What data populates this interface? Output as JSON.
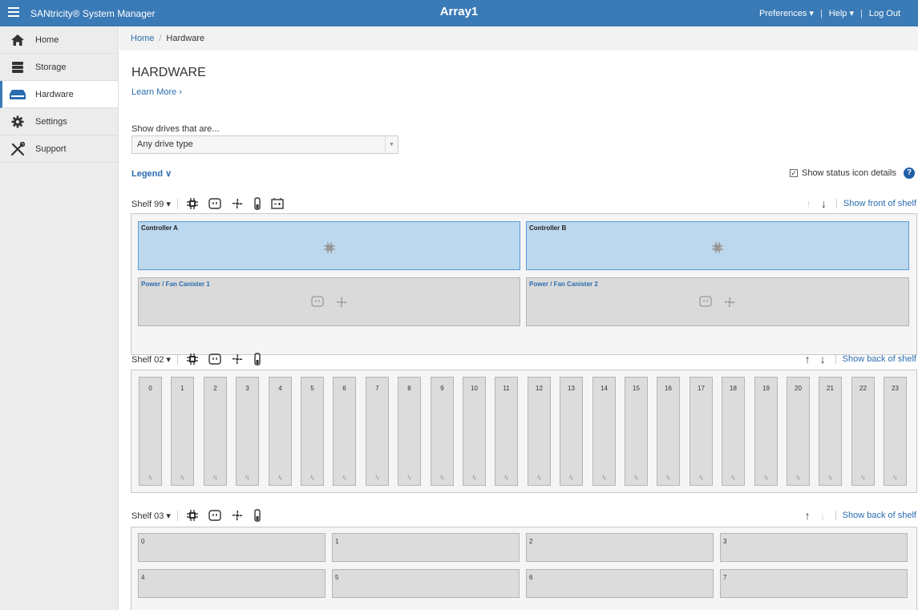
{
  "topbar": {
    "app_title": "SANtricity® System Manager",
    "array_name": "Array1",
    "preferences": "Preferences ▾",
    "help": "Help ▾",
    "logout": "Log Out",
    "separator": "|"
  },
  "sidebar": {
    "items": [
      {
        "label": "Home",
        "icon": "home-icon"
      },
      {
        "label": "Storage",
        "icon": "storage-icon"
      },
      {
        "label": "Hardware",
        "icon": "hardware-icon",
        "active": true
      },
      {
        "label": "Settings",
        "icon": "gear-icon"
      },
      {
        "label": "Support",
        "icon": "tools-icon"
      }
    ]
  },
  "breadcrumb": {
    "home": "Home",
    "separator": "/",
    "current": "Hardware"
  },
  "page": {
    "title": "HARDWARE",
    "learn_more": "Learn More ›",
    "filter_label": "Show drives that are...",
    "filter_value": "Any drive type",
    "filter_arrow": "▼",
    "legend": "Legend ∨",
    "status_details_checked": "✓",
    "status_details_label": "Show status icon details",
    "help_icon": "?"
  },
  "shelves": [
    {
      "name": "Shelf 99 ▾",
      "view_link": "Show front of shelf",
      "up_arrow": "↑",
      "down_arrow": "↓",
      "up_enabled": false,
      "down_enabled": true,
      "icons": [
        "controller-icon",
        "power-icon",
        "fan-icon",
        "temperature-icon",
        "battery-icon"
      ],
      "controllers": [
        "Controller A",
        "Controller B"
      ],
      "power_fan": [
        "Power / Fan Canister 1",
        "Power / Fan Canister 2"
      ]
    },
    {
      "name": "Shelf 02 ▾",
      "view_link": "Show back of shelf",
      "up_arrow": "↑",
      "down_arrow": "↓",
      "up_enabled": true,
      "down_enabled": true,
      "icons": [
        "controller-icon",
        "power-icon",
        "fan-icon",
        "temperature-icon"
      ],
      "bolt": "ϟ",
      "drives": [
        "0",
        "1",
        "2",
        "3",
        "4",
        "5",
        "6",
        "7",
        "8",
        "9",
        "10",
        "11",
        "12",
        "13",
        "14",
        "15",
        "16",
        "17",
        "18",
        "19",
        "20",
        "21",
        "22",
        "23"
      ]
    },
    {
      "name": "Shelf 03 ▾",
      "view_link": "Show back of shelf",
      "up_arrow": "↑",
      "down_arrow": "↓",
      "up_enabled": true,
      "down_enabled": false,
      "icons": [
        "controller-icon",
        "power-icon",
        "fan-icon",
        "temperature-icon"
      ],
      "drives": [
        "0",
        "1",
        "2",
        "3",
        "4",
        "5",
        "6",
        "7"
      ]
    }
  ],
  "colors": {
    "topbar": "#3a7ab6",
    "link": "#2a6cb0",
    "controller_fill": "#bcd8ee",
    "bay_fill": "#dcdcdc"
  }
}
